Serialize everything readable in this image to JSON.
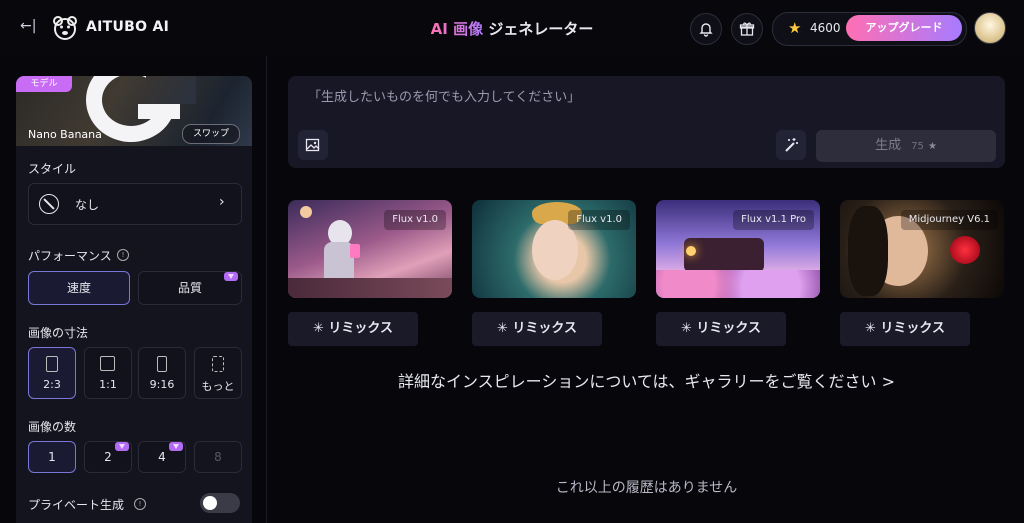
{
  "header": {
    "back_glyph": "←|",
    "brand": "AITUBO AI",
    "title_gradient": "AI 画像",
    "title_rest": " ジェネレーター",
    "credits": "4600",
    "upgrade_label": "アップグレード"
  },
  "sidebar": {
    "model": {
      "tag": "モデル",
      "name": "Nano Banana",
      "swap_label": "スワップ"
    },
    "style": {
      "heading": "スタイル",
      "value": "なし"
    },
    "performance": {
      "heading": "パフォーマンス",
      "options": [
        "速度",
        "品質"
      ],
      "selected": 0
    },
    "dimensions": {
      "heading": "画像の寸法",
      "options": [
        "2:3",
        "1:1",
        "9:16",
        "もっと"
      ],
      "selected": 0
    },
    "count": {
      "heading": "画像の数",
      "options": [
        "1",
        "2",
        "4",
        "8"
      ],
      "selected": 0
    },
    "private": {
      "label": "プライベート生成",
      "enabled": false
    }
  },
  "prompt": {
    "placeholder": "「生成したいものを何でも入力してください」",
    "generate_label": "生成",
    "generate_cost": "75"
  },
  "gallery": {
    "cards": [
      {
        "model": "Flux v1.0",
        "remix_label": "リミックス"
      },
      {
        "model": "Flux v1.0",
        "remix_label": "リミックス"
      },
      {
        "model": "Flux v1.1 Pro",
        "remix_label": "リミックス"
      },
      {
        "model": "Midjourney V6.1",
        "remix_label": "リミックス"
      }
    ],
    "inspiration_link": "詳細なインスピレーションについては、ギャラリーをご覧ください >",
    "no_more": "これ以上の履歴はありません"
  },
  "colors": {
    "accent_pink": "#ff6fb3",
    "accent_purple": "#a77bff",
    "selected_border": "#7a76d8",
    "gem": "#b26cf3"
  }
}
